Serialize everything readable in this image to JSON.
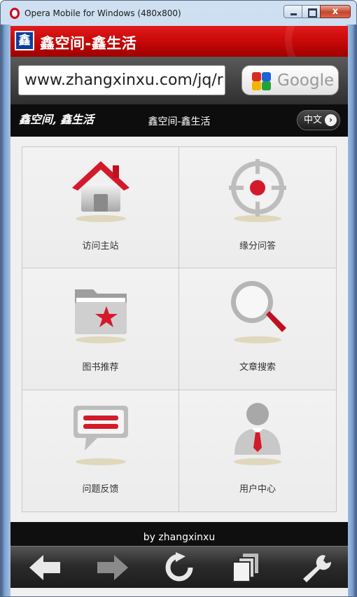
{
  "window": {
    "title": "Opera Mobile for Windows (480x800)",
    "close_label": "x"
  },
  "site": {
    "logo_char": "鑫",
    "title": "鑫空间-鑫生活"
  },
  "addressbar": {
    "url": "www.zhangxinxu.com/jq/r",
    "search_engine": "Google"
  },
  "subbar": {
    "logo_text": "鑫空间, 鑫生活",
    "title": "鑫空间-鑫生活",
    "lang_button": "中文"
  },
  "grid": {
    "items": [
      {
        "label": "访问主站",
        "icon": "home-icon"
      },
      {
        "label": "缘分问答",
        "icon": "target-icon"
      },
      {
        "label": "图书推荐",
        "icon": "folder-star-icon"
      },
      {
        "label": "文章搜索",
        "icon": "magnifier-icon"
      },
      {
        "label": "问题反馈",
        "icon": "speech-bubble-icon"
      },
      {
        "label": "用户中心",
        "icon": "user-icon"
      }
    ]
  },
  "footer": {
    "text": "by zhangxinxu"
  },
  "toolbar": {
    "buttons": [
      "back-arrow-icon",
      "forward-arrow-icon",
      "reload-icon",
      "tabs-icon",
      "wrench-icon"
    ]
  },
  "colors": {
    "header_red": "#c40707",
    "accent_red": "#d41a2a",
    "toolbar_dark": "#2b2b2b"
  }
}
